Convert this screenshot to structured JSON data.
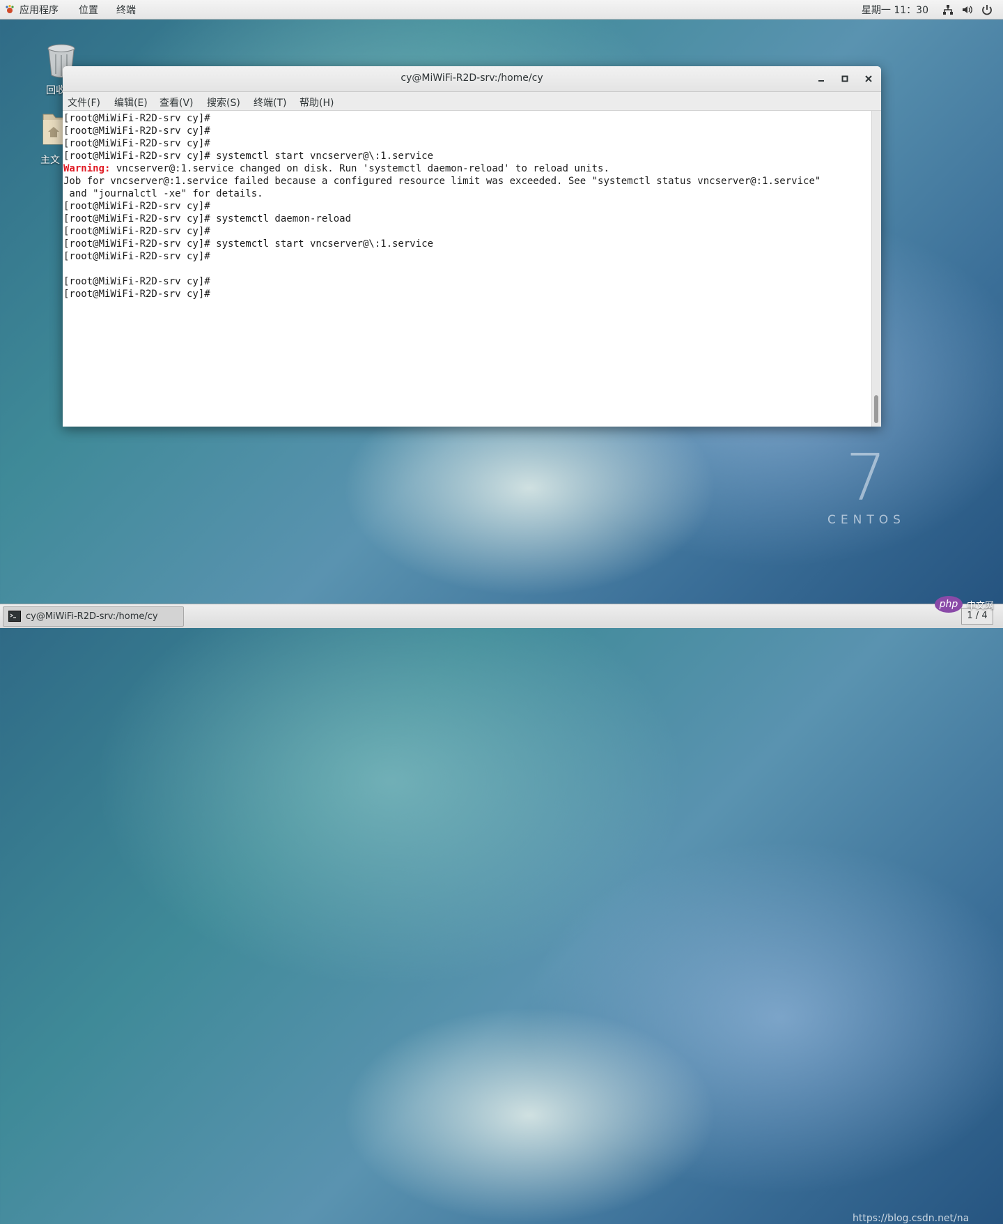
{
  "topbar": {
    "applications": "应用程序",
    "places": "位置",
    "terminal": "终端",
    "clock": "星期一 11：30"
  },
  "desktop": {
    "trash_label": "回收",
    "home_label": "主文"
  },
  "centos": {
    "version": "7",
    "word": "CENTOS"
  },
  "window": {
    "title": "cy@MiWiFi-R2D-srv:/home/cy",
    "menu": [
      "文件(F)",
      "编辑(E)",
      "查看(V)",
      "搜索(S)",
      "终端(T)",
      "帮助(H)"
    ]
  },
  "terminal": {
    "lines": [
      "[root@MiWiFi-R2D-srv cy]#",
      "[root@MiWiFi-R2D-srv cy]#",
      "[root@MiWiFi-R2D-srv cy]#",
      "[root@MiWiFi-R2D-srv cy]# systemctl start vncserver@\\:1.service",
      "vncserver@:1.service changed on disk. Run 'systemctl daemon-reload' to reload units.",
      "Job for vncserver@:1.service failed because a configured resource limit was exceeded. See \"systemctl status vncserver@:1.service\"",
      " and \"journalctl -xe\" for details.",
      "[root@MiWiFi-R2D-srv cy]#",
      "[root@MiWiFi-R2D-srv cy]# systemctl daemon-reload",
      "[root@MiWiFi-R2D-srv cy]#",
      "[root@MiWiFi-R2D-srv cy]# systemctl start vncserver@\\:1.service",
      "[root@MiWiFi-R2D-srv cy]#",
      "",
      "[root@MiWiFi-R2D-srv cy]#",
      "[root@MiWiFi-R2D-srv cy]#"
    ],
    "warning_prefix": "Warning:"
  },
  "taskbar": {
    "task_label": "cy@MiWiFi-R2D-srv:/home/cy",
    "pager": "1 / 4",
    "watermark": "https://blog.csdn.net/na",
    "php_badge": "php",
    "php_cn": "中文网"
  },
  "colors": {
    "warning": "#e01b24",
    "wallpaper": "#3f8a98"
  }
}
